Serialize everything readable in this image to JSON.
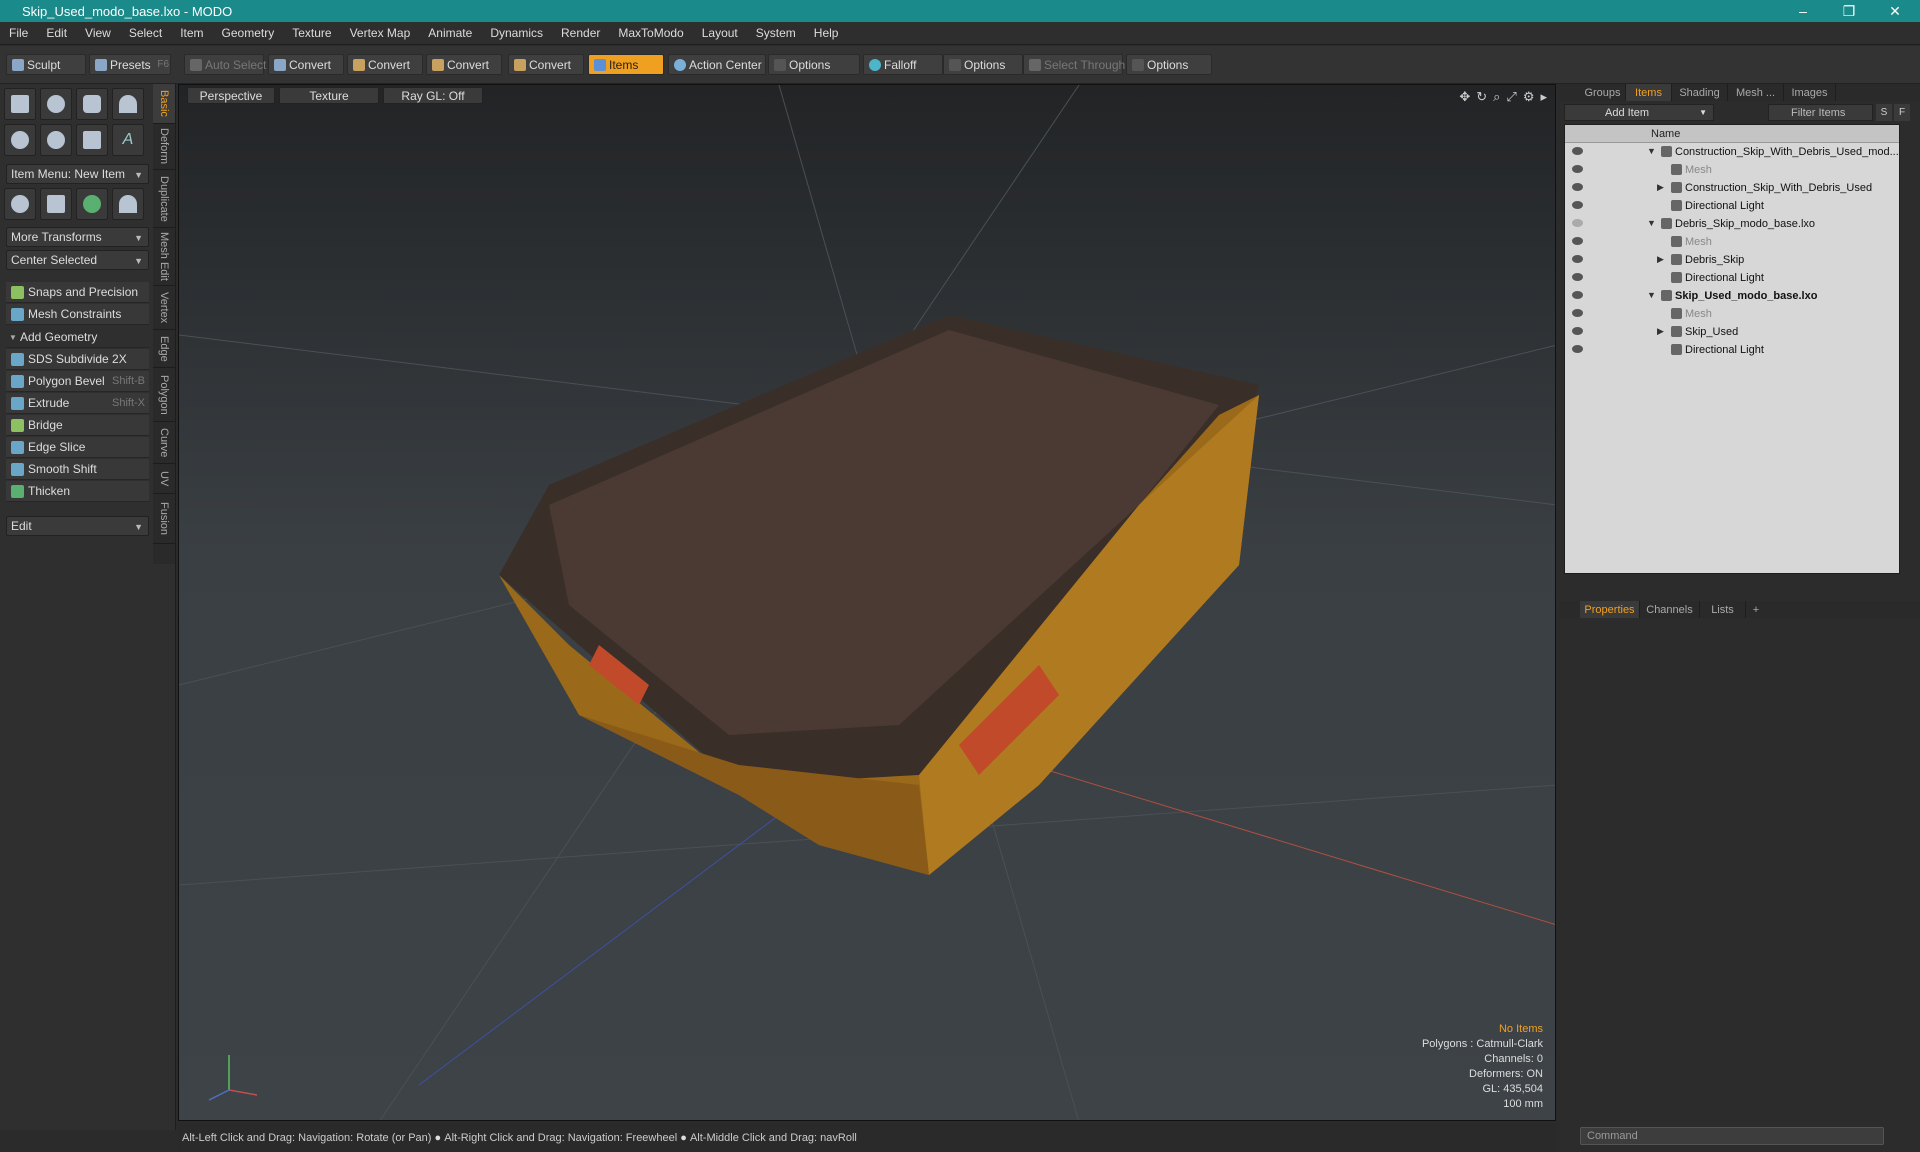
{
  "window": {
    "title": "Skip_Used_modo_base.lxo - MODO",
    "minimize": "–",
    "maximize": "❐",
    "close": "✕"
  },
  "menu": [
    "File",
    "Edit",
    "View",
    "Select",
    "Item",
    "Geometry",
    "Texture",
    "Vertex Map",
    "Animate",
    "Dynamics",
    "Render",
    "MaxToModo",
    "Layout",
    "System",
    "Help"
  ],
  "toolbar": {
    "sculpt": "Sculpt",
    "presets": "Presets",
    "presets_key": "F6",
    "auto_select": "Auto Select",
    "convert1": "Convert",
    "convert2": "Convert",
    "convert3": "Convert",
    "convert4": "Convert",
    "items": "Items",
    "action_center": "Action Center",
    "options1": "Options",
    "falloff": "Falloff",
    "options2": "Options",
    "select_through": "Select Through",
    "options3": "Options"
  },
  "left": {
    "item_menu": "Item Menu: New Item",
    "more_transforms": "More Transforms",
    "center_selected": "Center Selected",
    "snaps": "Snaps and Precision",
    "mesh_constraints": "Mesh Constraints",
    "add_geometry": "Add Geometry",
    "tools": [
      {
        "label": "SDS Subdivide 2X",
        "key": ""
      },
      {
        "label": "Polygon Bevel",
        "key": "Shift-B"
      },
      {
        "label": "Extrude",
        "key": "Shift-X"
      },
      {
        "label": "Bridge",
        "key": ""
      },
      {
        "label": "Edge Slice",
        "key": ""
      },
      {
        "label": "Smooth Shift",
        "key": ""
      },
      {
        "label": "Thicken",
        "key": ""
      }
    ],
    "edit": "Edit"
  },
  "vtabs": [
    "Basic",
    "Deform",
    "Duplicate",
    "Mesh Edit",
    "Vertex",
    "Edge",
    "Polygon",
    "Curve",
    "UV",
    "Fusion"
  ],
  "viewport": {
    "view": "Perspective",
    "shading": "Texture",
    "raygl": "Ray GL: Off",
    "info": {
      "items": "No Items",
      "polygons": "Polygons : Catmull-Clark",
      "channels": "Channels: 0",
      "deformers": "Deformers: ON",
      "gl": "GL: 435,504",
      "scale": "100 mm"
    }
  },
  "status": {
    "hint1": "Alt-Left Click and Drag: Navigation: Rotate (or Pan)",
    "hint2": "Alt-Right Click and Drag: Navigation: Freewheel",
    "hint3": "Alt-Middle Click and Drag: navRoll"
  },
  "right": {
    "tabs": [
      "Groups",
      "Items",
      "Shading",
      "Mesh ...",
      "Images"
    ],
    "add_item": "Add Item",
    "filter_items": "Filter Items",
    "s": "S",
    "f": "F",
    "col_name": "Name",
    "items": [
      {
        "label": "Construction_Skip_With_Debris_Used_mod...",
        "level": 0,
        "tri": "▼",
        "eye": true,
        "dim": false,
        "bold": false
      },
      {
        "label": "Mesh",
        "level": 1,
        "tri": "",
        "eye": true,
        "dim": true,
        "bold": false
      },
      {
        "label": "Construction_Skip_With_Debris_Used",
        "level": 1,
        "tri": "▶",
        "eye": true,
        "dim": false,
        "bold": false
      },
      {
        "label": "Directional Light",
        "level": 1,
        "tri": "",
        "eye": true,
        "dim": false,
        "bold": false
      },
      {
        "label": "Debris_Skip_modo_base.lxo",
        "level": 0,
        "tri": "▼",
        "eye": false,
        "dim": false,
        "bold": false
      },
      {
        "label": "Mesh",
        "level": 1,
        "tri": "",
        "eye": true,
        "dim": true,
        "bold": false
      },
      {
        "label": "Debris_Skip",
        "level": 1,
        "tri": "▶",
        "eye": true,
        "dim": false,
        "bold": false
      },
      {
        "label": "Directional Light",
        "level": 1,
        "tri": "",
        "eye": true,
        "dim": false,
        "bold": false
      },
      {
        "label": "Skip_Used_modo_base.lxo",
        "level": 0,
        "tri": "▼",
        "eye": true,
        "dim": false,
        "bold": true
      },
      {
        "label": "Mesh",
        "level": 1,
        "tri": "",
        "eye": true,
        "dim": true,
        "bold": false
      },
      {
        "label": "Skip_Used",
        "level": 1,
        "tri": "▶",
        "eye": true,
        "dim": false,
        "bold": false
      },
      {
        "label": "Directional Light",
        "level": 1,
        "tri": "",
        "eye": true,
        "dim": false,
        "bold": false
      }
    ],
    "bottom_tabs": [
      "Properties",
      "Channels",
      "Lists",
      "+"
    ],
    "command": "Command"
  }
}
